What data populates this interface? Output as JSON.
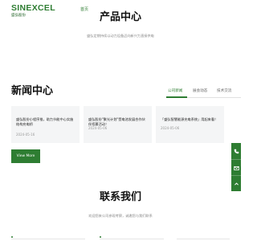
{
  "header": {
    "logo_main": "SINEXCEL",
    "logo_sub": "盛弘股份",
    "nav_home": "首页"
  },
  "products": {
    "title": "产品中心",
    "subtitle": "盛弘定期持续以动力设备迈向新兴力直接供电"
  },
  "news": {
    "title": "新闻中心",
    "tabs": [
      {
        "label": "公司新闻",
        "active": true
      },
      {
        "label": "展会动态",
        "active": false
      },
      {
        "label": "技术交流",
        "active": false
      }
    ],
    "cards": [
      {
        "title": "盛弘股份小程序推，助力节能中心实施结构充电桥",
        "date": "2024-05-16"
      },
      {
        "title": "盛弘股份\"聚光计划\"暨电池发展合作伙伴招募活动！",
        "date": "2024-05-06"
      },
      {
        "title": "「盛弘智慧能源充电系统」用起来看！",
        "date": "2024-05-06"
      }
    ],
    "view_more": "View More"
  },
  "contact": {
    "title": "联系我们",
    "subtitle": "欢迎您来公司参观考察，诚邀您与我们联系"
  },
  "colors": {
    "brand_green": "#2e7d32",
    "card_bg": "#f4f5f6"
  },
  "float_icons": [
    "phone-icon",
    "message-icon",
    "top-icon"
  ]
}
